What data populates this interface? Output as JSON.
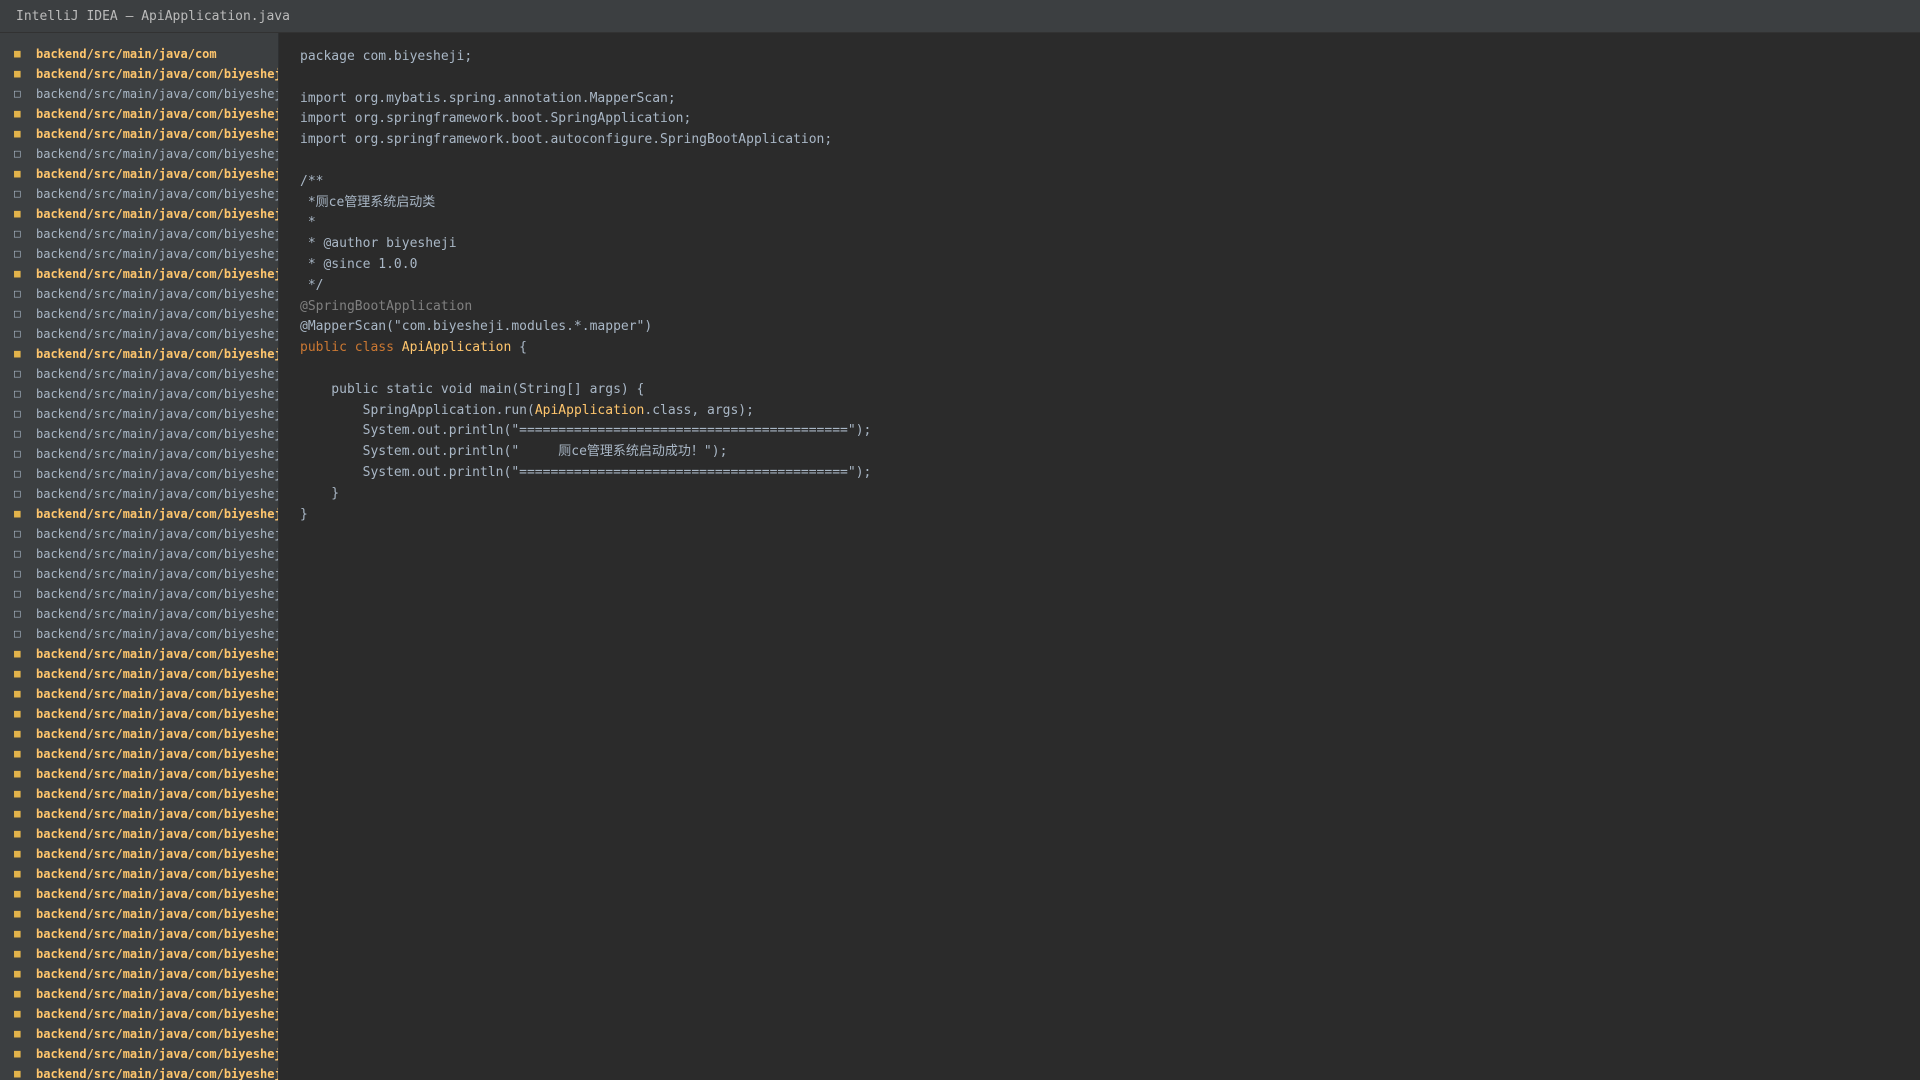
{
  "window": {
    "title": "IntelliJ IDEA — ApiApplication.java"
  },
  "colors": {
    "titlebar_bg": "#3c3f41",
    "sidebar_bg": "#3c3f41",
    "editor_bg": "#2b2b2b",
    "folder_text": "#ffc66d",
    "file_text": "#a9b7c6",
    "keyword": "#cc7832",
    "class_name": "#ffc66d",
    "annotation": "#808080"
  },
  "project_tree": {
    "items": [
      {
        "type": "folder",
        "icon": "folder-icon",
        "label": "backend/src/main/java/com"
      },
      {
        "type": "folder",
        "icon": "folder-icon",
        "label": "backend/src/main/java/com/biyeshej"
      },
      {
        "type": "file",
        "icon": "file-icon",
        "label": "backend/src/main/java/com/biyeshej"
      },
      {
        "type": "folder",
        "icon": "folder-icon",
        "label": "backend/src/main/java/com/biyeshej"
      },
      {
        "type": "folder",
        "icon": "folder-icon",
        "label": "backend/src/main/java/com/biyeshej"
      },
      {
        "type": "file",
        "icon": "file-icon",
        "label": "backend/src/main/java/com/biyeshej"
      },
      {
        "type": "folder",
        "icon": "folder-icon",
        "label": "backend/src/main/java/com/biyeshej"
      },
      {
        "type": "file",
        "icon": "file-icon",
        "label": "backend/src/main/java/com/biyeshej"
      },
      {
        "type": "folder",
        "icon": "folder-icon",
        "label": "backend/src/main/java/com/biyeshej"
      },
      {
        "type": "file",
        "icon": "file-icon",
        "label": "backend/src/main/java/com/biyeshej"
      },
      {
        "type": "file",
        "icon": "file-icon",
        "label": "backend/src/main/java/com/biyeshej"
      },
      {
        "type": "folder",
        "icon": "folder-icon",
        "label": "backend/src/main/java/com/biyeshej"
      },
      {
        "type": "file",
        "icon": "file-icon",
        "label": "backend/src/main/java/com/biyeshej"
      },
      {
        "type": "file",
        "icon": "file-icon",
        "label": "backend/src/main/java/com/biyeshej"
      },
      {
        "type": "file",
        "icon": "file-icon",
        "label": "backend/src/main/java/com/biyeshej"
      },
      {
        "type": "folder",
        "icon": "folder-icon",
        "label": "backend/src/main/java/com/biyeshej"
      },
      {
        "type": "file",
        "icon": "file-icon",
        "label": "backend/src/main/java/com/biyeshej"
      },
      {
        "type": "file",
        "icon": "file-icon",
        "label": "backend/src/main/java/com/biyeshej"
      },
      {
        "type": "file",
        "icon": "file-icon",
        "label": "backend/src/main/java/com/biyeshej"
      },
      {
        "type": "file",
        "icon": "file-icon",
        "label": "backend/src/main/java/com/biyeshej"
      },
      {
        "type": "file",
        "icon": "file-icon",
        "label": "backend/src/main/java/com/biyeshej"
      },
      {
        "type": "file",
        "icon": "file-icon",
        "label": "backend/src/main/java/com/biyeshej"
      },
      {
        "type": "file",
        "icon": "file-icon",
        "label": "backend/src/main/java/com/biyeshej"
      },
      {
        "type": "folder",
        "icon": "folder-icon",
        "label": "backend/src/main/java/com/biyeshej"
      },
      {
        "type": "file",
        "icon": "file-icon",
        "label": "backend/src/main/java/com/biyeshej"
      },
      {
        "type": "file",
        "icon": "file-icon",
        "label": "backend/src/main/java/com/biyeshej"
      },
      {
        "type": "file",
        "icon": "file-icon",
        "label": "backend/src/main/java/com/biyeshej"
      },
      {
        "type": "file",
        "icon": "file-icon",
        "label": "backend/src/main/java/com/biyeshej"
      },
      {
        "type": "file",
        "icon": "file-icon",
        "label": "backend/src/main/java/com/biyeshej"
      },
      {
        "type": "file",
        "icon": "file-icon",
        "label": "backend/src/main/java/com/biyeshej"
      },
      {
        "type": "folder",
        "icon": "folder-icon",
        "label": "backend/src/main/java/com/biyeshej"
      },
      {
        "type": "folder",
        "icon": "folder-icon",
        "label": "backend/src/main/java/com/biyeshej"
      },
      {
        "type": "folder",
        "icon": "folder-icon",
        "label": "backend/src/main/java/com/biyeshej"
      },
      {
        "type": "folder",
        "icon": "folder-icon",
        "label": "backend/src/main/java/com/biyeshej"
      },
      {
        "type": "folder",
        "icon": "folder-icon",
        "label": "backend/src/main/java/com/biyeshej"
      },
      {
        "type": "folder",
        "icon": "folder-icon",
        "label": "backend/src/main/java/com/biyeshej"
      },
      {
        "type": "folder",
        "icon": "folder-icon",
        "label": "backend/src/main/java/com/biyeshej"
      },
      {
        "type": "folder",
        "icon": "folder-icon",
        "label": "backend/src/main/java/com/biyeshej"
      },
      {
        "type": "folder",
        "icon": "folder-icon",
        "label": "backend/src/main/java/com/biyeshej"
      },
      {
        "type": "folder",
        "icon": "folder-icon",
        "label": "backend/src/main/java/com/biyeshej"
      },
      {
        "type": "folder",
        "icon": "folder-icon",
        "label": "backend/src/main/java/com/biyeshej"
      },
      {
        "type": "folder",
        "icon": "folder-icon",
        "label": "backend/src/main/java/com/biyeshej"
      },
      {
        "type": "folder",
        "icon": "folder-icon",
        "label": "backend/src/main/java/com/biyeshej"
      },
      {
        "type": "folder",
        "icon": "folder-icon",
        "label": "backend/src/main/java/com/biyeshej"
      },
      {
        "type": "folder",
        "icon": "folder-icon",
        "label": "backend/src/main/java/com/biyeshej"
      },
      {
        "type": "folder",
        "icon": "folder-icon",
        "label": "backend/src/main/java/com/biyeshej"
      },
      {
        "type": "folder",
        "icon": "folder-icon",
        "label": "backend/src/main/java/com/biyeshej"
      },
      {
        "type": "folder",
        "icon": "folder-icon",
        "label": "backend/src/main/java/com/biyeshej"
      },
      {
        "type": "folder",
        "icon": "folder-icon",
        "label": "backend/src/main/java/com/biyeshej"
      },
      {
        "type": "folder",
        "icon": "folder-icon",
        "label": "backend/src/main/java/com/biyeshej"
      },
      {
        "type": "folder",
        "icon": "folder-icon",
        "label": "backend/src/main/java/com/biyeshej"
      },
      {
        "type": "folder",
        "icon": "folder-icon",
        "label": "backend/src/main/java/com/biyeshej"
      }
    ]
  },
  "editor": {
    "lines": [
      [
        {
          "t": "package com.biyesheji;",
          "c": "plain"
        }
      ],
      [],
      [
        {
          "t": "import org.mybatis.spring.annotation.MapperScan;",
          "c": "plain"
        }
      ],
      [
        {
          "t": "import org.springframework.boot.SpringApplication;",
          "c": "plain"
        }
      ],
      [
        {
          "t": "import org.springframework.boot.autoconfigure.SpringBootApplication;",
          "c": "plain"
        }
      ],
      [],
      [
        {
          "t": "/**",
          "c": "cmt"
        }
      ],
      [
        {
          "t": " *厕ce管理系统启动类",
          "c": "cmt"
        }
      ],
      [
        {
          "t": " *",
          "c": "cmt"
        }
      ],
      [
        {
          "t": " * @author biyesheji",
          "c": "cmt"
        }
      ],
      [
        {
          "t": " * @since 1.0.0",
          "c": "cmt"
        }
      ],
      [
        {
          "t": " */",
          "c": "cmt"
        }
      ],
      [
        {
          "t": "@SpringBootApplication",
          "c": "ann"
        }
      ],
      [
        {
          "t": "@MapperScan(\"com.biyesheji.modules.*.mapper\")",
          "c": "plain"
        }
      ],
      [
        {
          "t": "public class ",
          "c": "kw"
        },
        {
          "t": "ApiApplication",
          "c": "cls"
        },
        {
          "t": " {",
          "c": "plain"
        }
      ],
      [],
      [
        {
          "t": "    public static void main(String[] args) {",
          "c": "plain"
        }
      ],
      [
        {
          "t": "        SpringApplication.run(",
          "c": "plain"
        },
        {
          "t": "ApiApplication",
          "c": "cls"
        },
        {
          "t": ".class, args);",
          "c": "plain"
        }
      ],
      [
        {
          "t": "        System.out.println(\"==========================================\");",
          "c": "plain"
        }
      ],
      [
        {
          "t": "        System.out.println(\"     厕ce管理系统启动成功！\");",
          "c": "plain"
        }
      ],
      [
        {
          "t": "        System.out.println(\"==========================================\");",
          "c": "plain"
        }
      ],
      [
        {
          "t": "    }",
          "c": "plain"
        }
      ],
      [
        {
          "t": "}",
          "c": "plain"
        }
      ]
    ]
  }
}
